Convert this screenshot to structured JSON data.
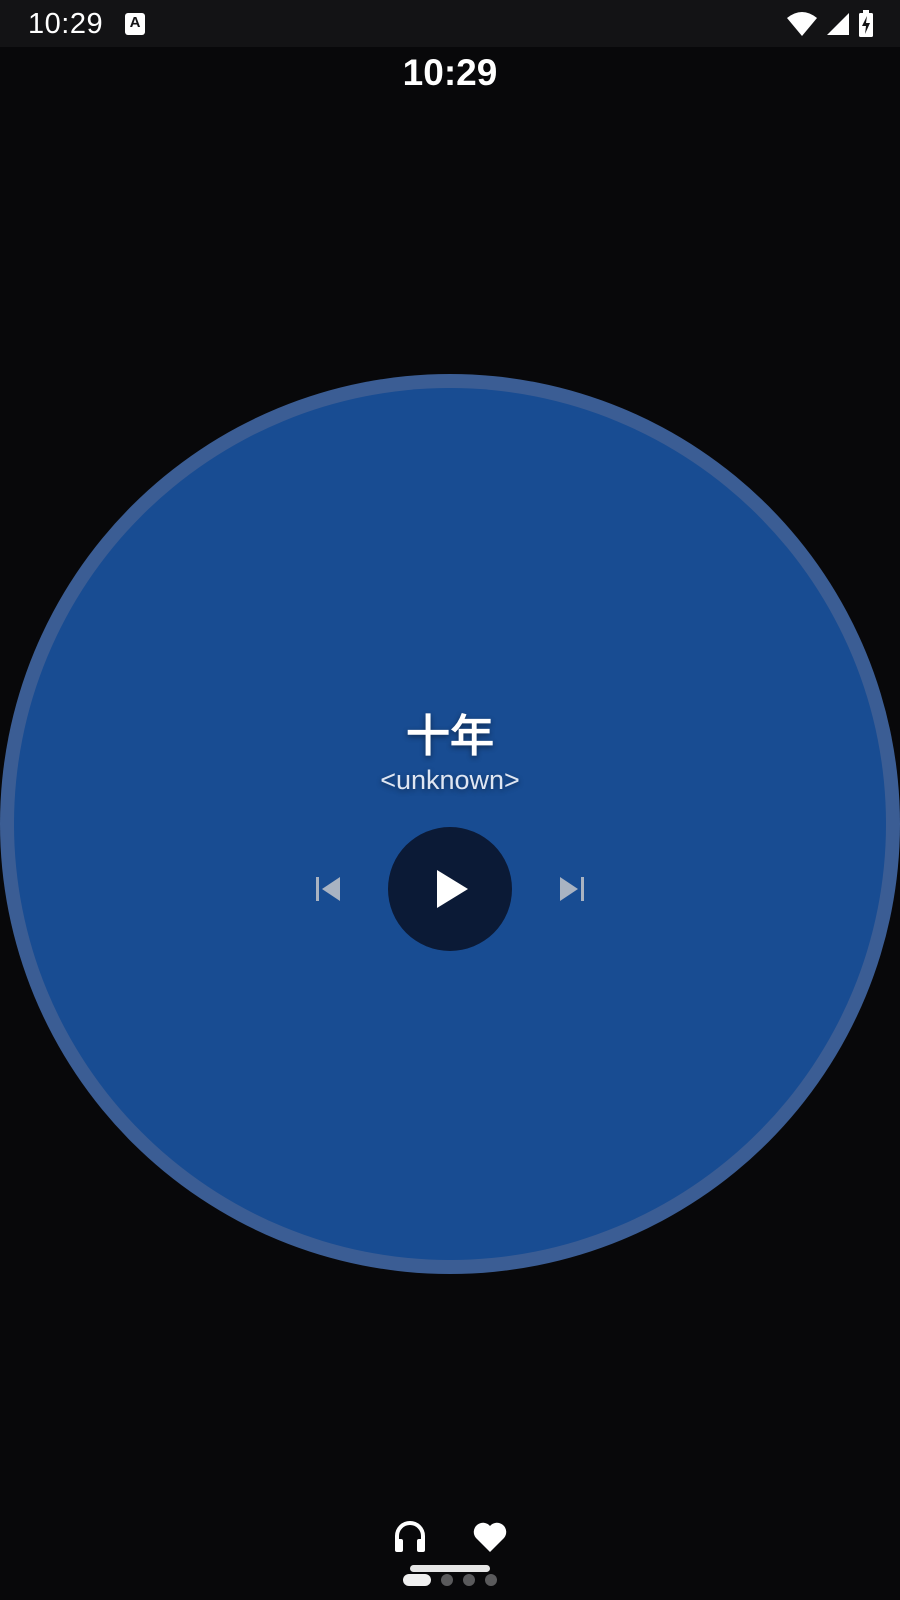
{
  "status_bar": {
    "time": "10:29",
    "notification_icon": "text-format-icon",
    "notification_icon_letter": "A",
    "icons": [
      "wifi-icon",
      "cell-signal-icon",
      "battery-charging-icon"
    ]
  },
  "watch": {
    "time": "10:29"
  },
  "player": {
    "title": "十年",
    "artist": "<unknown>",
    "state": "paused",
    "controls": [
      "skip-previous-icon",
      "play-icon",
      "skip-next-icon"
    ]
  },
  "bottom_nav": {
    "tabs": [
      {
        "icon": "headphones-icon"
      },
      {
        "icon": "heart-icon"
      }
    ],
    "page_count": 4,
    "active_page": 1
  },
  "colors": {
    "background": "#08080a",
    "disc_ring": "#3b5d94",
    "disc_fill": "#184c92",
    "play_button": "#0b1a36",
    "status_bar": "#131315"
  }
}
